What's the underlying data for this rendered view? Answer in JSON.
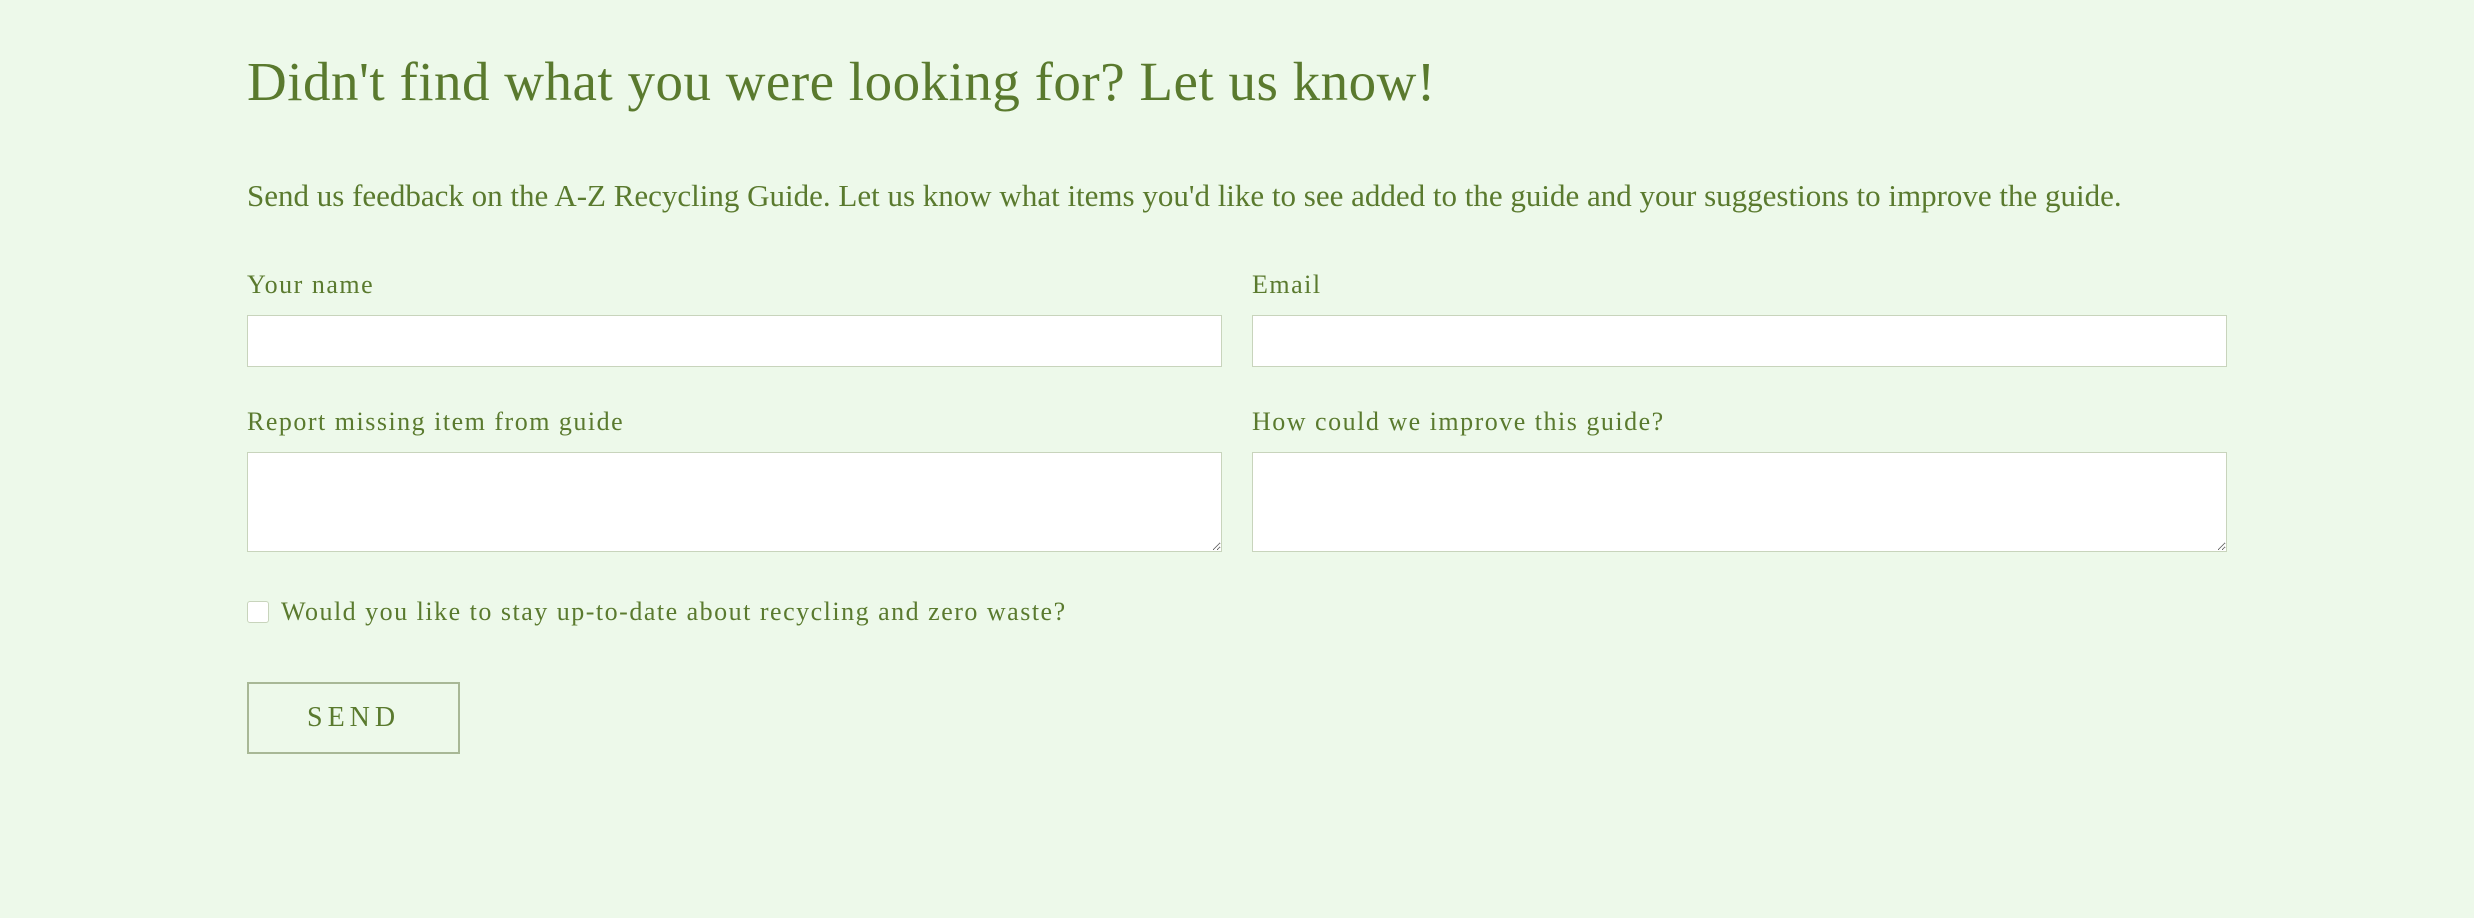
{
  "heading": "Didn't find what you were looking for? Let us know!",
  "intro": "Send us feedback on the A-Z Recycling Guide. Let us know what items you'd like to see added to the guide and your suggestions to improve the guide.",
  "fields": {
    "name": {
      "label": "Your name",
      "value": ""
    },
    "email": {
      "label": "Email",
      "value": ""
    },
    "missing_item": {
      "label": "Report missing item from guide",
      "value": ""
    },
    "improve": {
      "label": "How could we improve this guide?",
      "value": ""
    }
  },
  "checkbox": {
    "label": "Would you like to stay up-to-date about recycling and zero waste?",
    "checked": false
  },
  "submit_label": "SEND"
}
